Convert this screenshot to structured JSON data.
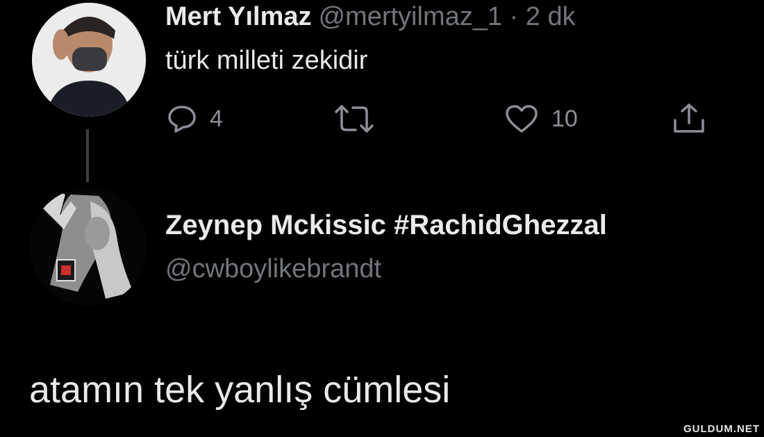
{
  "tweet": {
    "author_name": "Mert Yılmaz",
    "handle_time": "@mertyilmaz_1 · 2 dk",
    "text": "türk milleti zekidir",
    "reply_count": "4",
    "like_count": "10"
  },
  "reply": {
    "author_name": "Zeynep Mckissic #RachidGhezzal",
    "handle": "@cwboylikebrandt",
    "text": "atamın tek yanlış cümlesi"
  },
  "watermark": "GULDUM.NET",
  "icons": [
    "reply-icon",
    "retweet-icon",
    "like-icon",
    "share-icon"
  ],
  "colors": {
    "background": "#000000",
    "muted": "#71767b",
    "text": "#e7e9ea"
  }
}
